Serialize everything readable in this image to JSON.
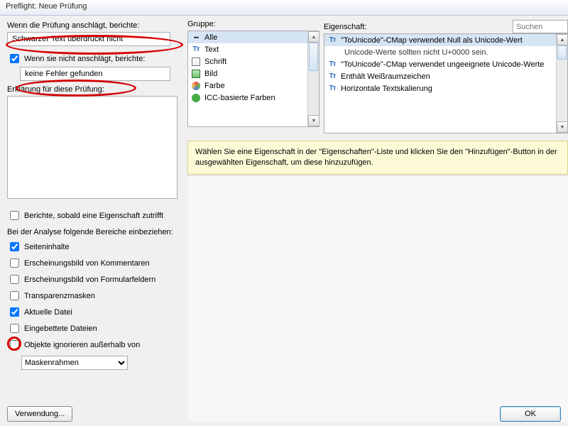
{
  "window": {
    "title": "Preflight: Neue Prüfung"
  },
  "left": {
    "heading1": "Wenn die Prüfung anschlägt, berichte:",
    "input1": "Schwarzer Text überdruckt nicht",
    "check1_label": "Wenn sie nicht anschlägt, berichte:",
    "input2": "keine Fehler gefunden",
    "explain_label": "Erklärung für diese Prüfung:",
    "report_label": "Berichte, sobald eine Eigenschaft zutrifft",
    "include_label": "Bei der Analyse folgende Bereiche einbeziehen:",
    "opts": {
      "seiten": "Seiteninhalte",
      "komm": "Erscheinungsbild von Kommentaren",
      "form": "Erscheinungsbild von Formularfeldern",
      "trans": "Transparenzmasken",
      "akt": "Aktuelle Datei",
      "emb": "Eingebettete Dateien",
      "ign": "Objekte ignorieren außerhalb von"
    },
    "mask_option": "Maskenrahmen",
    "verwendung": "Verwendung..."
  },
  "right": {
    "group_label": "Gruppe:",
    "prop_label": "Eigenschaft:",
    "search_placeholder": "Suchen",
    "groups": [
      "Alle",
      "Text",
      "Schrift",
      "Bild",
      "Farbe",
      "ICC-basierte Farben"
    ],
    "props": [
      "\"ToUnicode\"-CMap verwendet Null als Unicode-Wert",
      "Unicode-Werte sollten nicht U+0000 sein.",
      "\"ToUnicode\"-CMap verwendet ungeeignete Unicode-Werte",
      "Enthält Weißraumzeichen",
      "Horizontale Textskalierung"
    ],
    "hint": "Wählen Sie eine Eigenschaft in der \"Eigenschaften\"-Liste und klicken Sie den \"Hinzufügen\"-Button in der ausgewählten Eigenschaft, um diese hinzuzufügen."
  },
  "buttons": {
    "ok": "OK"
  }
}
